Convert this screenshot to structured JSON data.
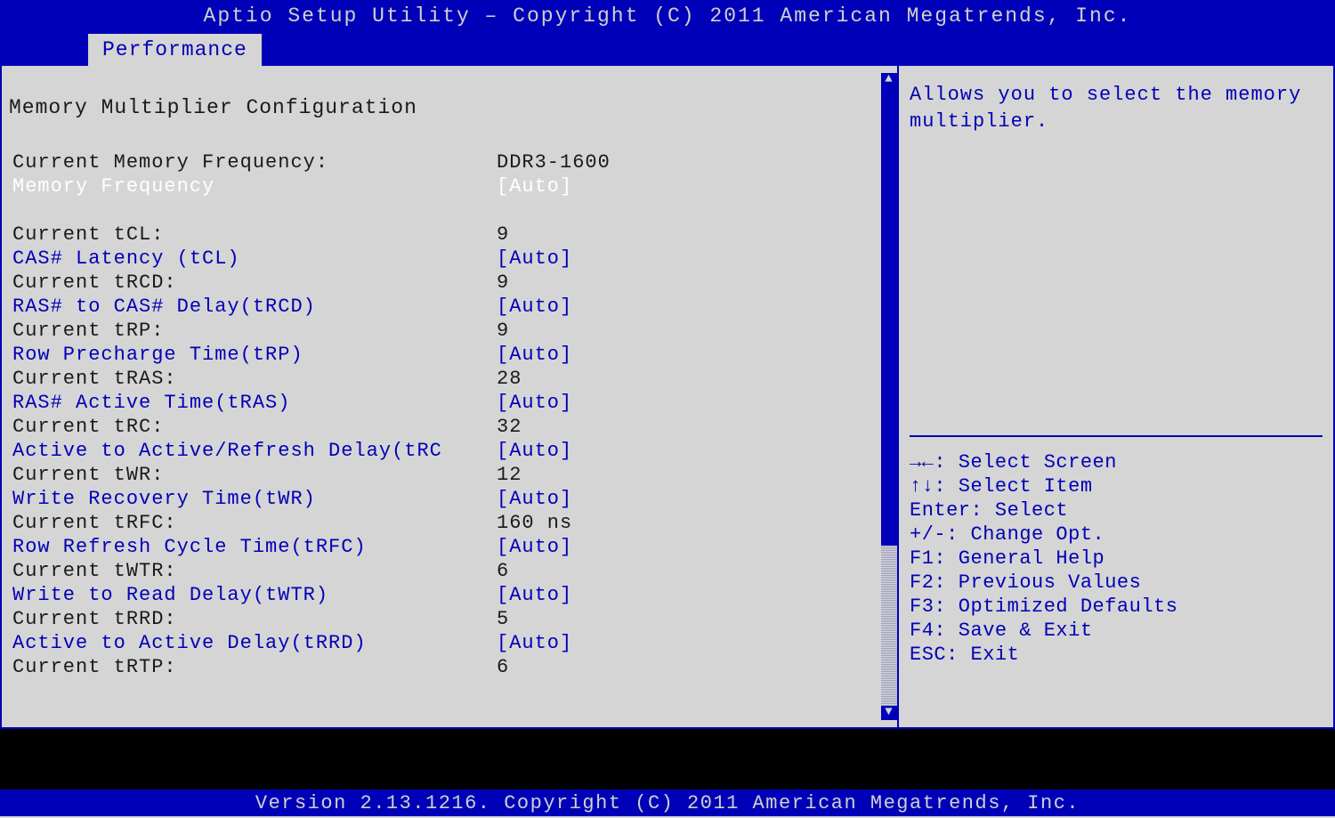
{
  "header": {
    "title": "Aptio Setup Utility – Copyright (C) 2011 American Megatrends, Inc.",
    "tab": "Performance"
  },
  "section_title": "Memory Multiplier Configuration",
  "rows": [
    {
      "label": "Current Memory Frequency:",
      "value": "DDR3-1600",
      "type": "static"
    },
    {
      "label": "Memory Frequency",
      "value": "[Auto]",
      "type": "selected"
    },
    {
      "label": "",
      "value": "",
      "type": "blank"
    },
    {
      "label": "Current tCL:",
      "value": "9",
      "type": "static"
    },
    {
      "label": "CAS# Latency (tCL)",
      "value": "[Auto]",
      "type": "setting"
    },
    {
      "label": "Current tRCD:",
      "value": "9",
      "type": "static"
    },
    {
      "label": "RAS# to CAS# Delay(tRCD)",
      "value": "[Auto]",
      "type": "setting"
    },
    {
      "label": "Current tRP:",
      "value": "9",
      "type": "static"
    },
    {
      "label": "Row Precharge Time(tRP)",
      "value": "[Auto]",
      "type": "setting"
    },
    {
      "label": "Current tRAS:",
      "value": "28",
      "type": "static"
    },
    {
      "label": "RAS# Active Time(tRAS)",
      "value": "[Auto]",
      "type": "setting"
    },
    {
      "label": "Current tRC:",
      "value": "32",
      "type": "static"
    },
    {
      "label": "Active to Active/Refresh Delay(tRC",
      "value": "[Auto]",
      "type": "setting"
    },
    {
      "label": "Current tWR:",
      "value": "12",
      "type": "static"
    },
    {
      "label": "Write Recovery Time(tWR)",
      "value": "[Auto]",
      "type": "setting"
    },
    {
      "label": "Current tRFC:",
      "value": "160 ns",
      "type": "static"
    },
    {
      "label": "Row Refresh Cycle Time(tRFC)",
      "value": "[Auto]",
      "type": "setting"
    },
    {
      "label": "Current tWTR:",
      "value": "6",
      "type": "static"
    },
    {
      "label": "Write to Read Delay(tWTR)",
      "value": "[Auto]",
      "type": "setting"
    },
    {
      "label": "Current tRRD:",
      "value": "5",
      "type": "static"
    },
    {
      "label": "Active to Active Delay(tRRD)",
      "value": "[Auto]",
      "type": "setting"
    },
    {
      "label": "Current tRTP:",
      "value": "6",
      "type": "static"
    }
  ],
  "help": {
    "text": "Allows you to select the memory multiplier.",
    "keys": [
      "→←: Select Screen",
      "↑↓: Select Item",
      "Enter: Select",
      "+/-: Change Opt.",
      "F1: General Help",
      "F2: Previous Values",
      "F3: Optimized Defaults",
      "F4: Save & Exit",
      "ESC: Exit"
    ]
  },
  "footer": "Version 2.13.1216. Copyright (C) 2011 American Megatrends, Inc."
}
